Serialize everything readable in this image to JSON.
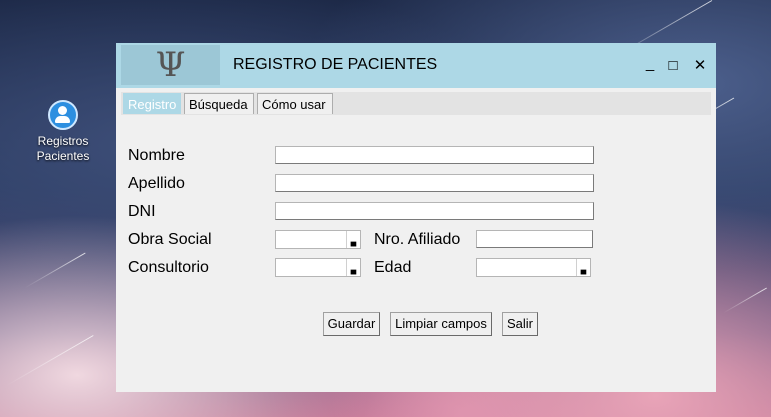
{
  "desktop": {
    "icon_label_line1": "Registros",
    "icon_label_line2": "Pacientes"
  },
  "window": {
    "logo_glyph": "Ψ",
    "title": "REGISTRO DE PACIENTES",
    "minimize_glyph": "_",
    "maximize_glyph": "□",
    "close_glyph": "✕",
    "titlebar_color": "#add8e6"
  },
  "tabs": [
    {
      "label": "Registro",
      "active": true
    },
    {
      "label": "Búsqueda",
      "active": false
    },
    {
      "label": "Cómo usar",
      "active": false
    }
  ],
  "form": {
    "nombre_label": "Nombre",
    "nombre_value": "",
    "apellido_label": "Apellido",
    "apellido_value": "",
    "dni_label": "DNI",
    "dni_value": "",
    "obra_social_label": "Obra Social",
    "obra_social_selected": "",
    "nro_afiliado_label": "Nro. Afiliado",
    "nro_afiliado_value": "",
    "consultorio_label": "Consultorio",
    "consultorio_selected": "",
    "edad_label": "Edad",
    "edad_selected": ""
  },
  "buttons": {
    "guardar": "Guardar",
    "limpiar": "Limpiar campos",
    "salir": "Salir"
  }
}
